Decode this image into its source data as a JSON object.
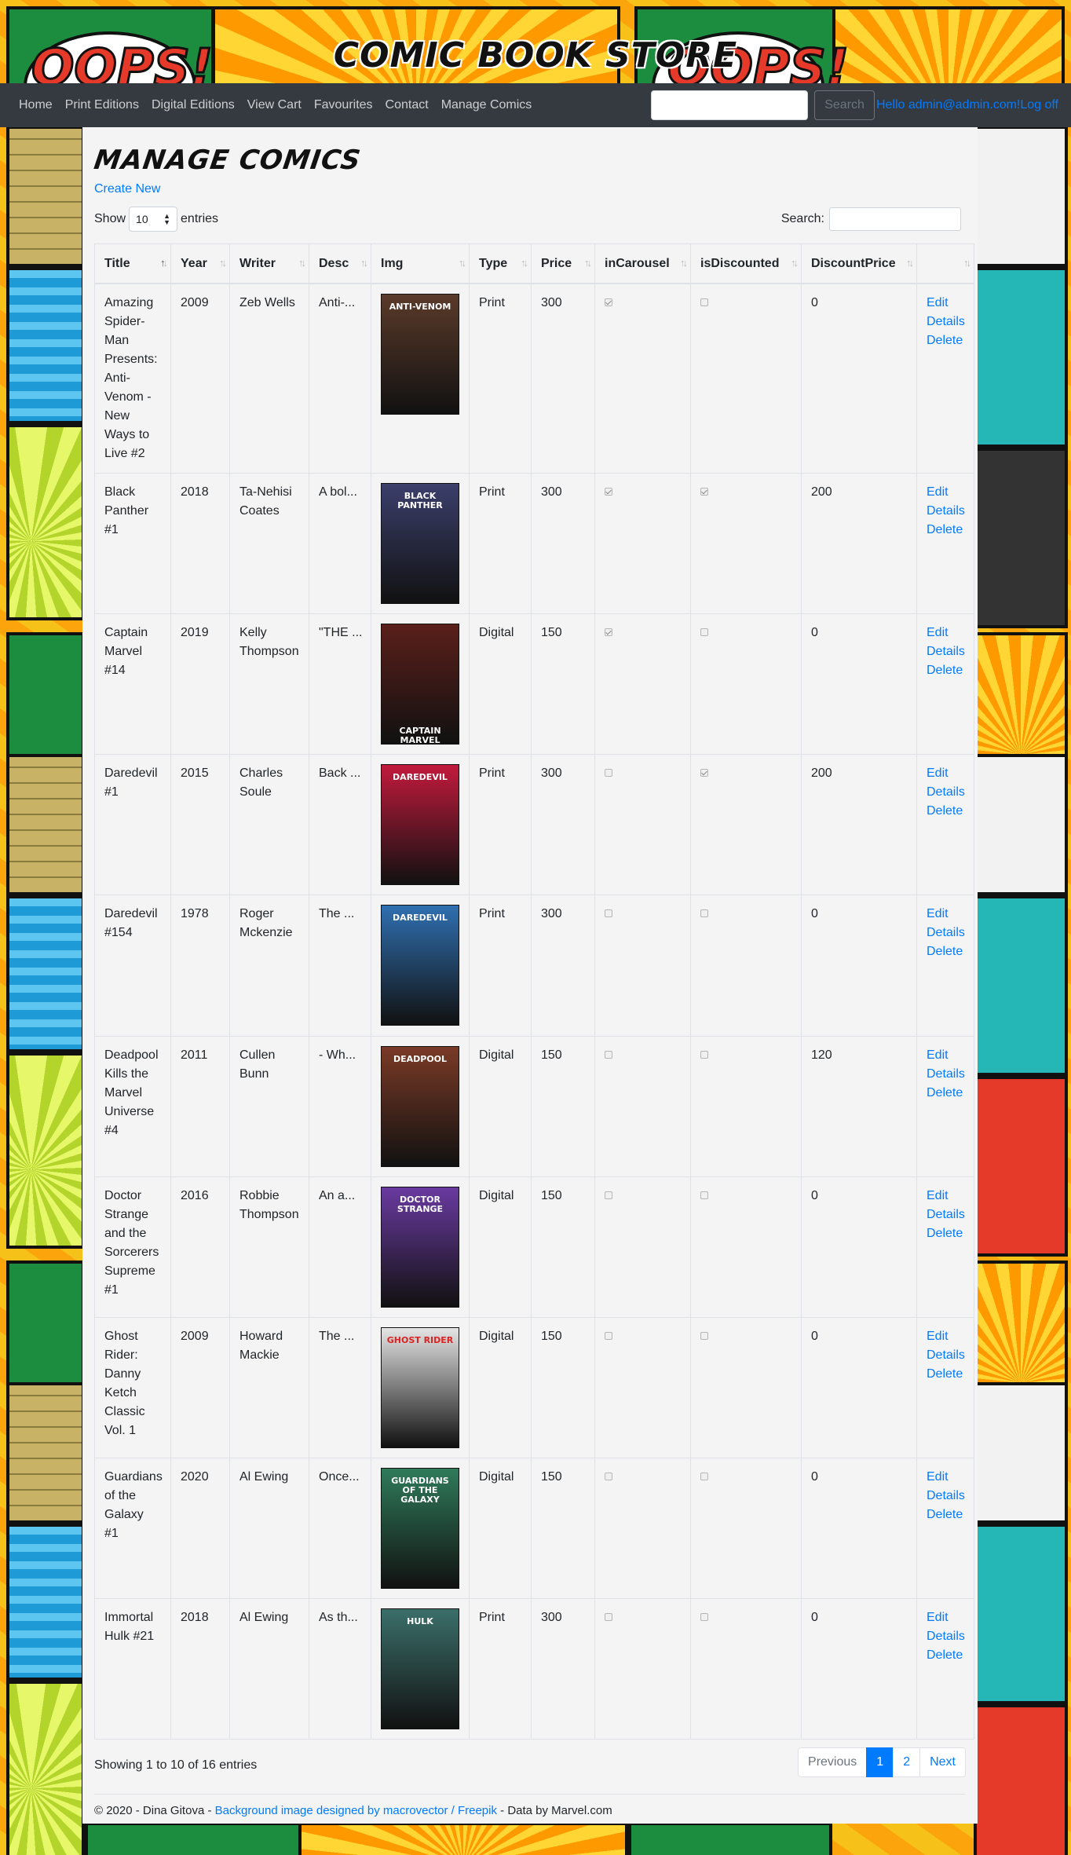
{
  "site": {
    "title": "COMIC BOOK STORE"
  },
  "nav": {
    "links": [
      "Home",
      "Print Editions",
      "Digital Editions",
      "View Cart",
      "Favourites",
      "Contact",
      "Manage Comics"
    ],
    "search_button": "Search",
    "user_greeting": "Hello admin@admin.com!",
    "logoff": "Log off"
  },
  "page": {
    "title": "MANAGE COMICS",
    "create_new": "Create New",
    "show_label": "Show",
    "entries_label": "entries",
    "page_length": "10",
    "search_label": "Search:"
  },
  "table": {
    "columns": [
      "Title",
      "Year",
      "Writer",
      "Desc",
      "Img",
      "Type",
      "Price",
      "inCarousel",
      "isDiscounted",
      "DiscountPrice",
      ""
    ],
    "rows": [
      {
        "title": "Amazing Spider-Man Presents: Anti-Venom - New Ways to Live #2",
        "year": "2009",
        "writer": "Zeb Wells",
        "desc": "Anti-...",
        "cover_text": "ANTI-VENOM",
        "cover_color": "#5a3a2a",
        "type": "Print",
        "price": "300",
        "in_carousel": true,
        "is_discounted": false,
        "discount_price": "0"
      },
      {
        "title": "Black Panther #1",
        "year": "2018",
        "writer": "Ta-Nehisi Coates",
        "desc": "A bol...",
        "cover_text": "BLACK PANTHER",
        "cover_color": "#3b3f6b",
        "type": "Print",
        "price": "300",
        "in_carousel": true,
        "is_discounted": true,
        "discount_price": "200"
      },
      {
        "title": "Captain Marvel #14",
        "year": "2019",
        "writer": "Kelly Thompson",
        "desc": "\"THE ...",
        "cover_text": "CAPTAIN MARVEL",
        "cover_color": "#5a1f1a",
        "type": "Digital",
        "price": "150",
        "in_carousel": true,
        "is_discounted": false,
        "discount_price": "0"
      },
      {
        "title": "Daredevil #1",
        "year": "2015",
        "writer": "Charles Soule",
        "desc": "Back ...",
        "cover_text": "DAREDEVIL",
        "cover_color": "#c21a3c",
        "type": "Print",
        "price": "300",
        "in_carousel": false,
        "is_discounted": true,
        "discount_price": "200"
      },
      {
        "title": "Daredevil #154",
        "year": "1978",
        "writer": "Roger Mckenzie",
        "desc": "The ...",
        "cover_text": "DAREDEVIL",
        "cover_color": "#2f6fb0",
        "type": "Print",
        "price": "300",
        "in_carousel": false,
        "is_discounted": false,
        "discount_price": "0"
      },
      {
        "title": "Deadpool Kills the Marvel Universe #4",
        "year": "2011",
        "writer": "Cullen Bunn",
        "desc": "- Wh...",
        "cover_text": "DEADPOOL",
        "cover_color": "#7a3a26",
        "type": "Digital",
        "price": "150",
        "in_carousel": false,
        "is_discounted": false,
        "discount_price": "120"
      },
      {
        "title": "Doctor Strange and the Sorcerers Supreme #1",
        "year": "2016",
        "writer": "Robbie Thompson",
        "desc": "An a...",
        "cover_text": "DOCTOR STRANGE",
        "cover_color": "#6a3aa0",
        "type": "Digital",
        "price": "150",
        "in_carousel": false,
        "is_discounted": false,
        "discount_price": "0"
      },
      {
        "title": "Ghost Rider: Danny Ketch Classic Vol. 1",
        "year": "2009",
        "writer": "Howard Mackie",
        "desc": "The ...",
        "cover_text": "GHOST RIDER",
        "cover_color": "#e4e4e4",
        "type": "Digital",
        "price": "150",
        "in_carousel": false,
        "is_discounted": false,
        "discount_price": "0"
      },
      {
        "title": "Guardians of the Galaxy #1",
        "year": "2020",
        "writer": "Al Ewing",
        "desc": "Once...",
        "cover_text": "GUARDIANS OF THE GALAXY",
        "cover_color": "#2f7a5a",
        "type": "Digital",
        "price": "150",
        "in_carousel": false,
        "is_discounted": false,
        "discount_price": "0"
      },
      {
        "title": "Immortal Hulk #21",
        "year": "2018",
        "writer": "Al Ewing",
        "desc": "As th...",
        "cover_text": "HULK",
        "cover_color": "#3b6f6a",
        "type": "Print",
        "price": "300",
        "in_carousel": false,
        "is_discounted": false,
        "discount_price": "0"
      }
    ],
    "action_labels": {
      "edit": "Edit",
      "details": "Details",
      "delete": "Delete"
    }
  },
  "footer_info": {
    "showing": "Showing 1 to 10 of 16 entries",
    "pagination": [
      "Previous",
      "1",
      "2",
      "Next"
    ]
  },
  "footer": {
    "copyright": "© 2020 - Dina Gitova -",
    "bg_credit_link": "Background image designed by macrovector / Freepik",
    "data_credit": "- Data by Marvel.com"
  },
  "colors": {
    "navbar": "#343a40",
    "link": "#007bff",
    "panel_bg": "#f4f4f4"
  }
}
